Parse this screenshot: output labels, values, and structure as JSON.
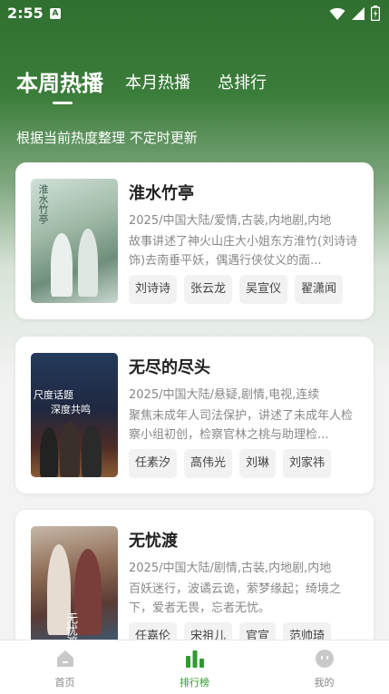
{
  "status": {
    "time": "2:55",
    "notif_letter": "A"
  },
  "tabs": [
    {
      "label": "本周热播"
    },
    {
      "label": "本月热播"
    },
    {
      "label": "总排行"
    }
  ],
  "subtitle": "根据当前热度整理 不定时更新",
  "cards": [
    {
      "title": "淮水竹亭",
      "meta": "2025/中国大陆/爱情,古装,内地剧,内地",
      "desc": "故事讲述了神火山庄大小姐东方淮竹(刘诗诗 饰)去南垂平妖，偶遇行侠仗义的面...",
      "tags": [
        "刘诗诗",
        "张云龙",
        "吴宣仪",
        "翟潇闻"
      ],
      "poster_text": "淮水竹亭"
    },
    {
      "title": "无尽的尽头",
      "meta": "2025/中国大陆/悬疑,剧情,电视,连续",
      "desc": "聚焦未成年人司法保护，讲述了未成年人检察小组初创，检察官林之桃与助理检...",
      "tags": [
        "任素汐",
        "高伟光",
        "刘琳",
        "刘家祎"
      ],
      "poster_text_1": "尺度话题",
      "poster_text_2": "深度共鸣"
    },
    {
      "title": "无忧渡",
      "meta": "2025/中国大陆/剧情,古装,内地剧,内地",
      "desc": "百妖迷行，波谲云诡，萦梦缘起；绮境之下，爱者无畏，忘者无忧。",
      "tags": [
        "任嘉伦",
        "宋祖儿",
        "官宣",
        "范帅琦"
      ],
      "poster_text": "无忧渡"
    }
  ],
  "nav": [
    {
      "label": "首页",
      "icon": "home-icon"
    },
    {
      "label": "排行榜",
      "icon": "ranking-icon"
    },
    {
      "label": "我的",
      "icon": "profile-icon"
    }
  ],
  "colors": {
    "accent": "#2e9b2e",
    "header_green": "#2f6f2f"
  }
}
